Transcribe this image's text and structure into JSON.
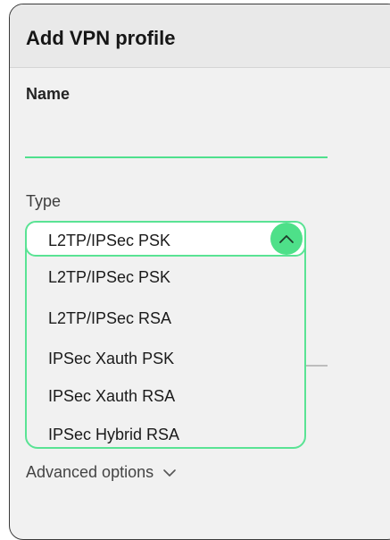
{
  "header": {
    "title": "Add VPN profile"
  },
  "name_field": {
    "label": "Name",
    "value": ""
  },
  "type_field": {
    "label": "Type",
    "selected": "L2TP/IPSec PSK",
    "options": [
      "L2TP/IPSec PSK",
      "L2TP/IPSec RSA",
      "IPSec Xauth PSK",
      "IPSec Xauth RSA",
      "IPSec Hybrid RSA"
    ]
  },
  "advanced": {
    "label": "Advanced options"
  },
  "colors": {
    "accent": "#4ee089",
    "accent_border": "#5ae394",
    "dialog_bg": "#f1f1f1"
  },
  "icons": {
    "collapse": "chevron-up-icon",
    "expand": "chevron-down-icon"
  }
}
